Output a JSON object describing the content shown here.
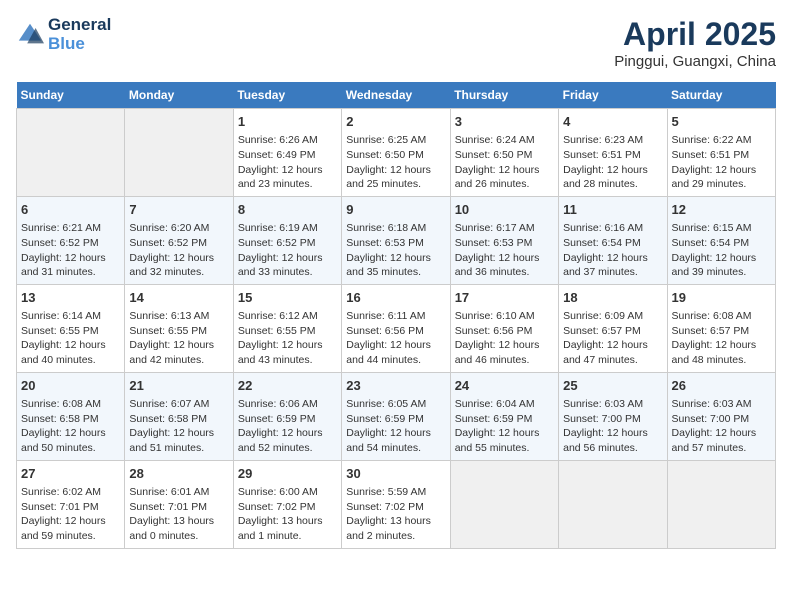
{
  "logo": {
    "line1": "General",
    "line2": "Blue"
  },
  "title": "April 2025",
  "subtitle": "Pinggui, Guangxi, China",
  "headers": [
    "Sunday",
    "Monday",
    "Tuesday",
    "Wednesday",
    "Thursday",
    "Friday",
    "Saturday"
  ],
  "weeks": [
    [
      {
        "day": "",
        "sunrise": "",
        "sunset": "",
        "daylight": ""
      },
      {
        "day": "",
        "sunrise": "",
        "sunset": "",
        "daylight": ""
      },
      {
        "day": "1",
        "sunrise": "Sunrise: 6:26 AM",
        "sunset": "Sunset: 6:49 PM",
        "daylight": "Daylight: 12 hours and 23 minutes."
      },
      {
        "day": "2",
        "sunrise": "Sunrise: 6:25 AM",
        "sunset": "Sunset: 6:50 PM",
        "daylight": "Daylight: 12 hours and 25 minutes."
      },
      {
        "day": "3",
        "sunrise": "Sunrise: 6:24 AM",
        "sunset": "Sunset: 6:50 PM",
        "daylight": "Daylight: 12 hours and 26 minutes."
      },
      {
        "day": "4",
        "sunrise": "Sunrise: 6:23 AM",
        "sunset": "Sunset: 6:51 PM",
        "daylight": "Daylight: 12 hours and 28 minutes."
      },
      {
        "day": "5",
        "sunrise": "Sunrise: 6:22 AM",
        "sunset": "Sunset: 6:51 PM",
        "daylight": "Daylight: 12 hours and 29 minutes."
      }
    ],
    [
      {
        "day": "6",
        "sunrise": "Sunrise: 6:21 AM",
        "sunset": "Sunset: 6:52 PM",
        "daylight": "Daylight: 12 hours and 31 minutes."
      },
      {
        "day": "7",
        "sunrise": "Sunrise: 6:20 AM",
        "sunset": "Sunset: 6:52 PM",
        "daylight": "Daylight: 12 hours and 32 minutes."
      },
      {
        "day": "8",
        "sunrise": "Sunrise: 6:19 AM",
        "sunset": "Sunset: 6:52 PM",
        "daylight": "Daylight: 12 hours and 33 minutes."
      },
      {
        "day": "9",
        "sunrise": "Sunrise: 6:18 AM",
        "sunset": "Sunset: 6:53 PM",
        "daylight": "Daylight: 12 hours and 35 minutes."
      },
      {
        "day": "10",
        "sunrise": "Sunrise: 6:17 AM",
        "sunset": "Sunset: 6:53 PM",
        "daylight": "Daylight: 12 hours and 36 minutes."
      },
      {
        "day": "11",
        "sunrise": "Sunrise: 6:16 AM",
        "sunset": "Sunset: 6:54 PM",
        "daylight": "Daylight: 12 hours and 37 minutes."
      },
      {
        "day": "12",
        "sunrise": "Sunrise: 6:15 AM",
        "sunset": "Sunset: 6:54 PM",
        "daylight": "Daylight: 12 hours and 39 minutes."
      }
    ],
    [
      {
        "day": "13",
        "sunrise": "Sunrise: 6:14 AM",
        "sunset": "Sunset: 6:55 PM",
        "daylight": "Daylight: 12 hours and 40 minutes."
      },
      {
        "day": "14",
        "sunrise": "Sunrise: 6:13 AM",
        "sunset": "Sunset: 6:55 PM",
        "daylight": "Daylight: 12 hours and 42 minutes."
      },
      {
        "day": "15",
        "sunrise": "Sunrise: 6:12 AM",
        "sunset": "Sunset: 6:55 PM",
        "daylight": "Daylight: 12 hours and 43 minutes."
      },
      {
        "day": "16",
        "sunrise": "Sunrise: 6:11 AM",
        "sunset": "Sunset: 6:56 PM",
        "daylight": "Daylight: 12 hours and 44 minutes."
      },
      {
        "day": "17",
        "sunrise": "Sunrise: 6:10 AM",
        "sunset": "Sunset: 6:56 PM",
        "daylight": "Daylight: 12 hours and 46 minutes."
      },
      {
        "day": "18",
        "sunrise": "Sunrise: 6:09 AM",
        "sunset": "Sunset: 6:57 PM",
        "daylight": "Daylight: 12 hours and 47 minutes."
      },
      {
        "day": "19",
        "sunrise": "Sunrise: 6:08 AM",
        "sunset": "Sunset: 6:57 PM",
        "daylight": "Daylight: 12 hours and 48 minutes."
      }
    ],
    [
      {
        "day": "20",
        "sunrise": "Sunrise: 6:08 AM",
        "sunset": "Sunset: 6:58 PM",
        "daylight": "Daylight: 12 hours and 50 minutes."
      },
      {
        "day": "21",
        "sunrise": "Sunrise: 6:07 AM",
        "sunset": "Sunset: 6:58 PM",
        "daylight": "Daylight: 12 hours and 51 minutes."
      },
      {
        "day": "22",
        "sunrise": "Sunrise: 6:06 AM",
        "sunset": "Sunset: 6:59 PM",
        "daylight": "Daylight: 12 hours and 52 minutes."
      },
      {
        "day": "23",
        "sunrise": "Sunrise: 6:05 AM",
        "sunset": "Sunset: 6:59 PM",
        "daylight": "Daylight: 12 hours and 54 minutes."
      },
      {
        "day": "24",
        "sunrise": "Sunrise: 6:04 AM",
        "sunset": "Sunset: 6:59 PM",
        "daylight": "Daylight: 12 hours and 55 minutes."
      },
      {
        "day": "25",
        "sunrise": "Sunrise: 6:03 AM",
        "sunset": "Sunset: 7:00 PM",
        "daylight": "Daylight: 12 hours and 56 minutes."
      },
      {
        "day": "26",
        "sunrise": "Sunrise: 6:03 AM",
        "sunset": "Sunset: 7:00 PM",
        "daylight": "Daylight: 12 hours and 57 minutes."
      }
    ],
    [
      {
        "day": "27",
        "sunrise": "Sunrise: 6:02 AM",
        "sunset": "Sunset: 7:01 PM",
        "daylight": "Daylight: 12 hours and 59 minutes."
      },
      {
        "day": "28",
        "sunrise": "Sunrise: 6:01 AM",
        "sunset": "Sunset: 7:01 PM",
        "daylight": "Daylight: 13 hours and 0 minutes."
      },
      {
        "day": "29",
        "sunrise": "Sunrise: 6:00 AM",
        "sunset": "Sunset: 7:02 PM",
        "daylight": "Daylight: 13 hours and 1 minute."
      },
      {
        "day": "30",
        "sunrise": "Sunrise: 5:59 AM",
        "sunset": "Sunset: 7:02 PM",
        "daylight": "Daylight: 13 hours and 2 minutes."
      },
      {
        "day": "",
        "sunrise": "",
        "sunset": "",
        "daylight": ""
      },
      {
        "day": "",
        "sunrise": "",
        "sunset": "",
        "daylight": ""
      },
      {
        "day": "",
        "sunrise": "",
        "sunset": "",
        "daylight": ""
      }
    ]
  ]
}
